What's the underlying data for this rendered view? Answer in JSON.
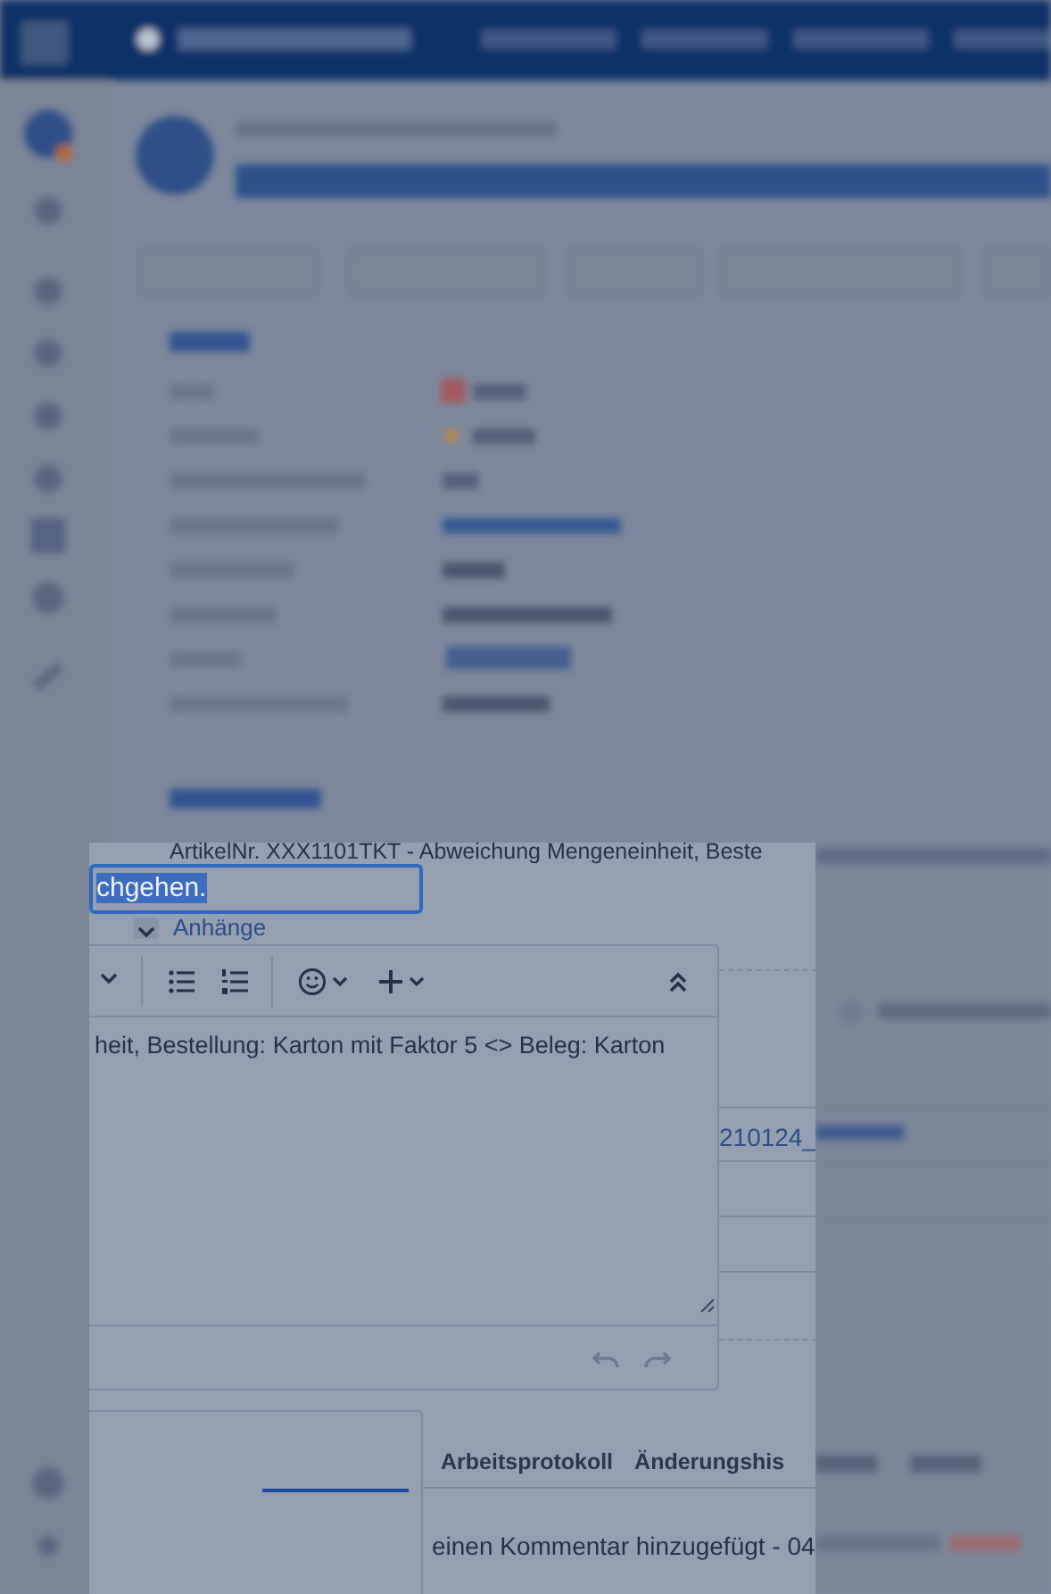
{
  "description_line": "ArtikelNr. XXX1101TKT - Abweichung Mengeneinheit, Beste",
  "summary_field": {
    "value": "chgehen.",
    "text_selected": true
  },
  "attachments_section": {
    "label": "Anhänge",
    "expanded": true
  },
  "editor": {
    "toolbar": [
      {
        "kind": "caret"
      },
      {
        "kind": "bullet-list"
      },
      {
        "kind": "numbered-list"
      },
      {
        "kind": "emoji"
      },
      {
        "kind": "insert"
      },
      {
        "kind": "collapse"
      }
    ],
    "text": "heit, Bestellung: Karton mit Faktor 5 <> Beleg: Karton"
  },
  "attachment_link": "210124_",
  "tabs": [
    {
      "label": "Arbeitsprotokoll",
      "selected": false
    },
    {
      "label": "Änderungshis",
      "selected": false
    }
  ],
  "activity_line": "einen Kommentar hinzugefügt - 04"
}
